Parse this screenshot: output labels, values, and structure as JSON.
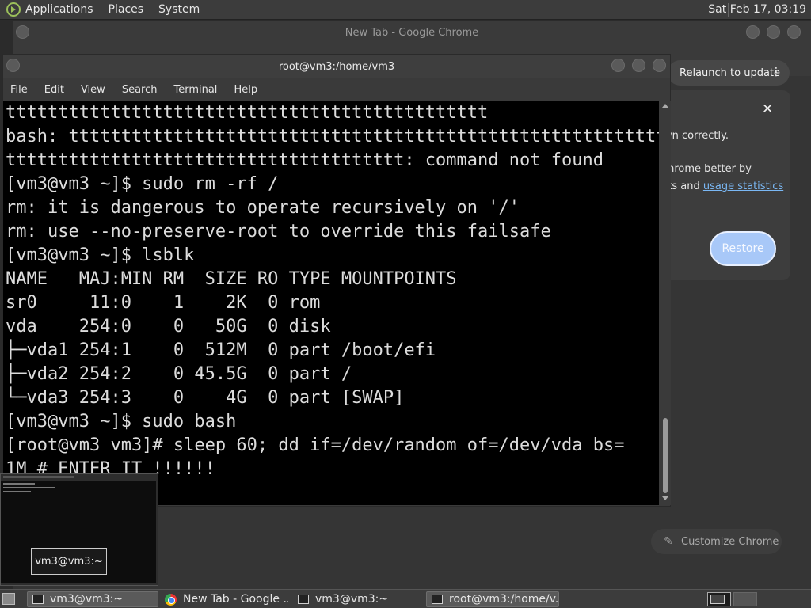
{
  "top_panel": {
    "menus": [
      "Applications",
      "Places",
      "System"
    ],
    "clock": "Sat Feb 17, 03:19"
  },
  "chrome": {
    "title": "New Tab - Google Chrome",
    "relaunch_label": "Relaunch to update",
    "relaunch_menu": "⋮",
    "popup": {
      "close": "✕",
      "line1": "own correctly.",
      "line2": "Chrome better by",
      "line3_prefix": "orts and ",
      "line3_link": "usage statistics",
      "restore_label": "Restore"
    },
    "customize_label": "Customize Chrome",
    "customize_icon": "✎"
  },
  "terminal": {
    "title": "root@vm3:/home/vm3",
    "menu": [
      "File",
      "Edit",
      "View",
      "Search",
      "Terminal",
      "Help"
    ],
    "lines": [
      "tttttttttttttttttttttttttttttttttttttttttttttt",
      "bash: tttttttttttttttttttttttttttttttttttttttttttttttttttttttttt",
      "tttttttttttttttttttttttttttttttttttttt: command not found",
      "[vm3@vm3 ~]$ sudo rm -rf /",
      "rm: it is dangerous to operate recursively on '/'",
      "rm: use --no-preserve-root to override this failsafe",
      "[vm3@vm3 ~]$ lsblk",
      "NAME   MAJ:MIN RM  SIZE RO TYPE MOUNTPOINTS",
      "sr0     11:0    1    2K  0 rom",
      "vda    254:0    0   50G  0 disk",
      "├─vda1 254:1    0  512M  0 part /boot/efi",
      "├─vda2 254:2    0 45.5G  0 part /",
      "└─vda3 254:3    0    4G  0 part [SWAP]",
      "[vm3@vm3 ~]$ sudo bash",
      "[root@vm3 vm3]# sleep 60; dd if=/dev/random of=/dev/vda bs=",
      "1M # ENTER IT !!!!!!"
    ]
  },
  "thumbnail": {
    "label": "vm3@vm3:~"
  },
  "taskbar": {
    "items": [
      {
        "label": "vm3@vm3:~",
        "icon": "terminal-icon"
      },
      {
        "label": "New Tab - Google ...",
        "icon": "chrome-icon"
      },
      {
        "label": "vm3@vm3:~",
        "icon": "terminal-icon"
      },
      {
        "label": "root@vm3:/home/v...",
        "icon": "terminal-icon"
      }
    ]
  }
}
